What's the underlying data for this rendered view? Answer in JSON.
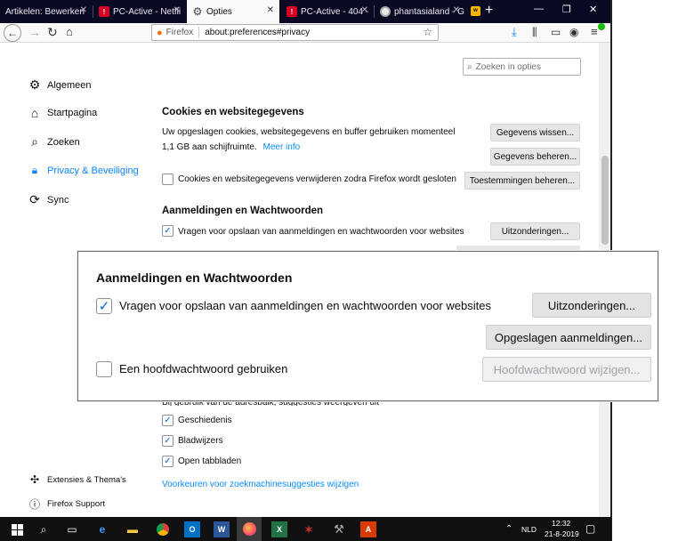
{
  "tabs": [
    {
      "label": "Artikelen: Bewerken"
    },
    {
      "label": "PC-Active - Netfli"
    },
    {
      "label": "Opties"
    },
    {
      "label": "PC-Active - 404 -"
    },
    {
      "label": "phantasialand - G"
    }
  ],
  "urlbar": {
    "identity": "Firefox",
    "url": "about:preferences#privacy"
  },
  "search": {
    "placeholder": "Zoeken in opties"
  },
  "sidebar": {
    "items": [
      {
        "label": "Algemeen"
      },
      {
        "label": "Startpagina"
      },
      {
        "label": "Zoeken"
      },
      {
        "label": "Privacy & Beveiliging"
      },
      {
        "label": "Sync"
      }
    ],
    "bottom": [
      {
        "label": "Extensies & Thema's"
      },
      {
        "label": "Firefox Support"
      }
    ]
  },
  "cookies": {
    "title": "Cookies en websitegegevens",
    "desc": "Uw opgeslagen cookies, websitegegevens en buffer gebruiken momenteel",
    "size": "1,1 GB aan schijfruimte.",
    "more_info": "Meer info",
    "clear_button": "Gegevens wissen...",
    "manage_button": "Gegevens beheren...",
    "delete_on_close": "Cookies en websitegegevens verwijderen zodra Firefox wordt gesloten",
    "permissions_button": "Toestemmingen beheren..."
  },
  "logins": {
    "title": "Aanmeldingen en Wachtwoorden",
    "ask_save": "Vragen voor opslaan van aanmeldingen en wachtwoorden voor websites",
    "exceptions_button": "Uitzonderingen..."
  },
  "zoom": {
    "title": "Aanmeldingen en Wachtwoorden",
    "ask_save": "Vragen voor opslaan van aanmeldingen en wachtwoorden voor websites",
    "exceptions_button": "Uitzonderingen...",
    "saved_logins_button": "Opgeslagen aanmeldingen...",
    "master_password": "Een hoofdwachtwoord gebruiken",
    "change_master_button": "Hoofdwachtwoord wijzigen..."
  },
  "addressbar": {
    "intro": "Bij gebruik van de adresbalk, suggesties weergeven uit",
    "options": [
      {
        "label": "Geschiedenis",
        "checked": true
      },
      {
        "label": "Bladwijzers",
        "checked": true
      },
      {
        "label": "Open tabbladen",
        "checked": true
      }
    ],
    "search_suggestions_link": "Voorkeuren voor zoekmachinesuggesties wijzigen"
  },
  "taskbar": {
    "language": "NLD",
    "time": "12:32",
    "date": "21-8-2019"
  },
  "colors": {
    "accent": "#0a84ff",
    "checkbox": "#0060df",
    "tabstrip": "#0a0a23",
    "taskbar": "#101010"
  }
}
